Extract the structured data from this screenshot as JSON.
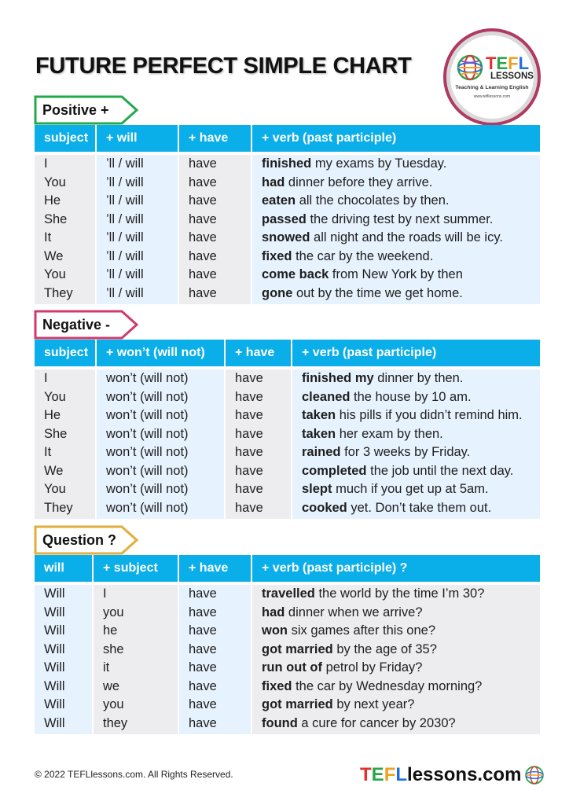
{
  "title": "FUTURE PERFECT SIMPLE CHART",
  "logo": {
    "letters": [
      "T",
      "E",
      "F",
      "L"
    ],
    "line2": "LESSONS",
    "tagline": "Teaching & Learning English",
    "url": "www.tefllessons.com",
    "icon": "globe-icon"
  },
  "colors": {
    "header_blue": "#0aaee8",
    "positive_tag": "#22a94a",
    "negative_tag": "#cf3a6b",
    "question_tag": "#e2ad3c",
    "cell_gray": "#ededf0",
    "cell_blue": "#e6f2fd",
    "badge_ring": "#b03a62"
  },
  "sections": {
    "positive": {
      "tag": "Positive +",
      "headers": [
        "subject",
        "+ will",
        "+ have",
        "+ verb (past participle)"
      ],
      "col1": [
        "I",
        "You",
        "He",
        "She",
        "It",
        "We",
        "You",
        "They"
      ],
      "col2": [
        "’ll / will",
        "’ll / will",
        "’ll / will",
        "’ll / will",
        "’ll / will",
        "’ll / will",
        "’ll / will",
        "’ll / will"
      ],
      "col3": [
        "have",
        "have",
        "have",
        "have",
        "have",
        "have",
        "have",
        "have"
      ],
      "verbs": [
        {
          "bold": "finished",
          "rest": " my exams by Tuesday."
        },
        {
          "bold": "had",
          "rest": " dinner before they arrive."
        },
        {
          "bold": "eaten",
          "rest": " all the chocolates by then."
        },
        {
          "bold": "passed",
          "rest": " the driving test by next summer."
        },
        {
          "bold": "snowed",
          "rest": " all night and the roads will be icy."
        },
        {
          "bold": "fixed",
          "rest": " the car by the weekend."
        },
        {
          "bold": "come back",
          "rest": " from New York by then"
        },
        {
          "bold": "gone",
          "rest": " out by the time we get home."
        }
      ]
    },
    "negative": {
      "tag": "Negative -",
      "headers": [
        "subject",
        "+ won’t (will not)",
        "+ have",
        " + verb (past participle)"
      ],
      "col1": [
        "I",
        "You",
        "He",
        "She",
        "It",
        "We",
        "You",
        "They"
      ],
      "col2": [
        "won’t (will not)",
        "won’t (will not)",
        "won’t (will not)",
        "won’t (will not)",
        "won’t (will not)",
        "won’t (will not)",
        "won’t (will not)",
        "won’t (will not)"
      ],
      "col3": [
        "have",
        "have",
        "have",
        "have",
        "have",
        "have",
        "have",
        "have"
      ],
      "verbs": [
        {
          "bold": "finished my",
          "rest": " dinner by then."
        },
        {
          "bold": "cleaned",
          "rest": " the house by 10 am."
        },
        {
          "bold": "taken",
          "rest": " his pills if you didn’t remind him."
        },
        {
          "bold": "taken",
          "rest": " her exam by then."
        },
        {
          "bold": "rained",
          "rest": " for 3 weeks by Friday."
        },
        {
          "bold": "completed",
          "rest": " the job until the next day."
        },
        {
          "bold": "slept",
          "rest": " much if you get up at 5am."
        },
        {
          "bold": "cooked",
          "rest": " yet. Don’t take them out."
        }
      ]
    },
    "question": {
      "tag": "Question ?",
      "headers": [
        "will",
        "+  subject",
        "+ have",
        "+ verb (past participle) ?"
      ],
      "col1": [
        "Will",
        "Will",
        "Will",
        "Will",
        "Will",
        "Will",
        "Will",
        "Will"
      ],
      "col2": [
        "I",
        "you",
        "he",
        "she",
        "it",
        "we",
        "you",
        "they"
      ],
      "col3": [
        "have",
        "have",
        "have",
        "have",
        "have",
        "have",
        "have",
        "have"
      ],
      "verbs": [
        {
          "bold": "travelled",
          "rest": " the world by the time I’m 30?"
        },
        {
          "bold": "had",
          "rest": " dinner when we arrive?"
        },
        {
          "bold": "won",
          "rest": " six games after this one?"
        },
        {
          "bold": "got married",
          "rest": " by the age of 35?"
        },
        {
          "bold": "run out of",
          "rest": " petrol by Friday?"
        },
        {
          "bold": "fixed",
          "rest": " the car by Wednesday morning?"
        },
        {
          "bold": "got married",
          "rest": " by next year?"
        },
        {
          "bold": "found",
          "rest": " a cure for cancer by 2030?"
        }
      ]
    }
  },
  "footer": {
    "copyright": "© 2022 TEFLlessons.com. All Rights Reserved.",
    "brand_letters": [
      "T",
      "E",
      "F",
      "L"
    ],
    "brand_rest": "lessons.com"
  }
}
